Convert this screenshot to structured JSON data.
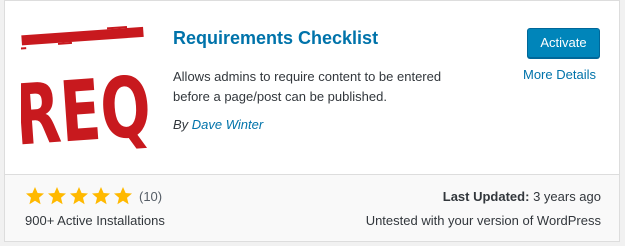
{
  "plugin": {
    "name": "Requirements Checklist",
    "description_line1": "Allows admins to require content to be entered",
    "description_line2": "before a page/post can be published.",
    "by_label": "By",
    "author": "Dave Winter",
    "logo_text": "REQ",
    "logo_color": "#c8191e"
  },
  "actions": {
    "activate_label": "Activate",
    "more_details_label": "More Details",
    "accent_color": "#0085ba"
  },
  "footer": {
    "rating": 5,
    "rating_max": 5,
    "rating_count": "(10)",
    "star_color": "#ffb900",
    "installs": "900+ Active Installations",
    "last_updated_label": "Last Updated:",
    "last_updated_value": "3 years ago",
    "compatibility": "Untested with your version of WordPress"
  }
}
